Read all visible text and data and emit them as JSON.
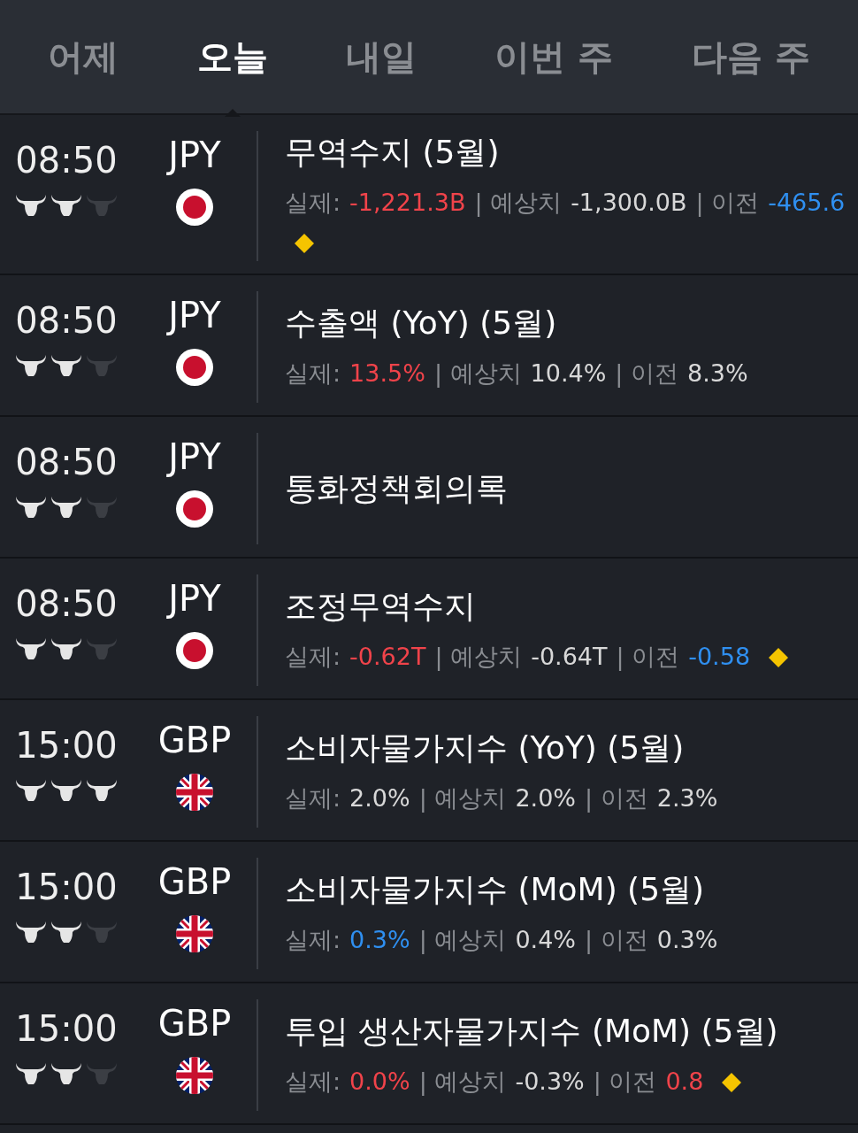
{
  "tabs": [
    {
      "label": "어제",
      "selected": false
    },
    {
      "label": "오늘",
      "selected": true
    },
    {
      "label": "내일",
      "selected": false
    },
    {
      "label": "이번 주",
      "selected": false
    },
    {
      "label": "다음 주",
      "selected": false
    }
  ],
  "events": [
    {
      "time": "08:50",
      "currency": "JPY",
      "flag": {
        "kind": "jp"
      },
      "stars": 2,
      "title": "무역수지 (5월)",
      "revised": true,
      "figures": [
        {
          "label": "실제:",
          "value": "-1,221.3B",
          "color": "#f0434a"
        },
        {
          "label": "| 예상치",
          "value": "-1,300.0B",
          "color": "#d8d8d8"
        },
        {
          "label": "| 이전",
          "value": "-465.6",
          "color": "#2f8ff0"
        }
      ]
    },
    {
      "time": "08:50",
      "currency": "JPY",
      "flag": {
        "kind": "jp"
      },
      "stars": 2,
      "title": "수출액 (YoY) (5월)",
      "revised": false,
      "figures": [
        {
          "label": "실제:",
          "value": "13.5%",
          "color": "#f0434a"
        },
        {
          "label": "| 예상치",
          "value": "10.4%",
          "color": "#d8d8d8"
        },
        {
          "label": "| 이전",
          "value": "8.3%",
          "color": "#d8d8d8"
        }
      ]
    },
    {
      "time": "08:50",
      "currency": "JPY",
      "flag": {
        "kind": "jp"
      },
      "stars": 2,
      "title": "통화정책회의록"
    },
    {
      "time": "08:50",
      "currency": "JPY",
      "flag": {
        "kind": "jp"
      },
      "stars": 2,
      "title": "조정무역수지",
      "revised": true,
      "figures": [
        {
          "label": "실제:",
          "value": "-0.62T",
          "color": "#f0434a"
        },
        {
          "label": "| 예상치",
          "value": "-0.64T",
          "color": "#d8d8d8"
        },
        {
          "label": "| 이전",
          "value": "-0.58",
          "color": "#2f8ff0"
        }
      ]
    },
    {
      "time": "15:00",
      "currency": "GBP",
      "flag": {
        "kind": "gb"
      },
      "stars": 3,
      "title": "소비자물가지수 (YoY) (5월)",
      "revised": false,
      "figures": [
        {
          "label": "실제:",
          "value": "2.0%",
          "color": "#d8d8d8"
        },
        {
          "label": "| 예상치",
          "value": "2.0%",
          "color": "#d8d8d8"
        },
        {
          "label": "| 이전",
          "value": "2.3%",
          "color": "#d8d8d8"
        }
      ]
    },
    {
      "time": "15:00",
      "currency": "GBP",
      "flag": {
        "kind": "gb"
      },
      "stars": 2,
      "title": "소비자물가지수 (MoM) (5월)",
      "revised": false,
      "figures": [
        {
          "label": "실제:",
          "value": "0.3%",
          "color": "#2f8ff0"
        },
        {
          "label": "| 예상치",
          "value": "0.4%",
          "color": "#d8d8d8"
        },
        {
          "label": "| 이전",
          "value": "0.3%",
          "color": "#d8d8d8"
        }
      ]
    },
    {
      "time": "15:00",
      "currency": "GBP",
      "flag": {
        "kind": "gb"
      },
      "stars": 2,
      "title": "투입 생산자물가지수 (MoM) (5월)",
      "revised": true,
      "figures": [
        {
          "label": "실제:",
          "value": "0.0%",
          "color": "#f0434a"
        },
        {
          "label": "| 예상치",
          "value": "-0.3%",
          "color": "#d8d8d8"
        },
        {
          "label": "| 이전",
          "value": "0.8",
          "color": "#f0434a"
        }
      ]
    }
  ]
}
